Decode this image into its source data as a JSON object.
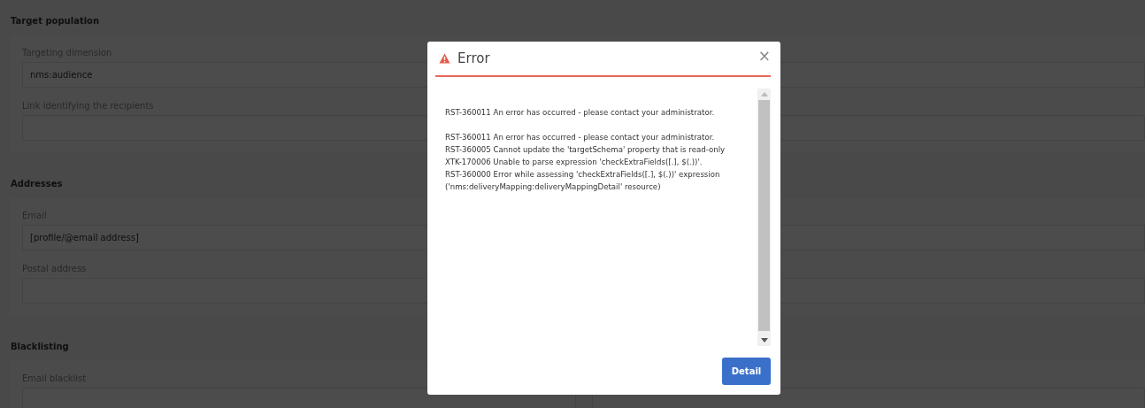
{
  "sections": [
    {
      "title": "Target population",
      "fields": [
        {
          "label": "Targeting dimension",
          "value": "nms:audience"
        },
        {
          "label": "Link identifying the recipients"
        }
      ]
    },
    {
      "title": "Addresses",
      "fields": [
        {
          "label": "Email",
          "value": "[profile/@email address]"
        },
        {
          "label": "Postal address"
        }
      ]
    },
    {
      "title": "Blacklisting",
      "fields": [
        {
          "label": "Email blacklist"
        }
      ]
    }
  ],
  "dialog": {
    "title": "Error",
    "close": "×",
    "paragraphs": [
      [
        "RST-360011 An error has occurred - please contact your administrator."
      ],
      [
        "RST-360011 An error has occurred - please contact your administrator.",
        "RST-360005 Cannot update the 'targetSchema' property that is read-only",
        "XTK-170006 Unable to parse expression 'checkExtraFields([.], $(.))'.",
        "RST-360000 Error while assessing 'checkExtraFields([.], $(.))' expression",
        "('nms:deliveryMapping:deliveryMappingDetail' resource)"
      ]
    ],
    "button": "Detail"
  }
}
